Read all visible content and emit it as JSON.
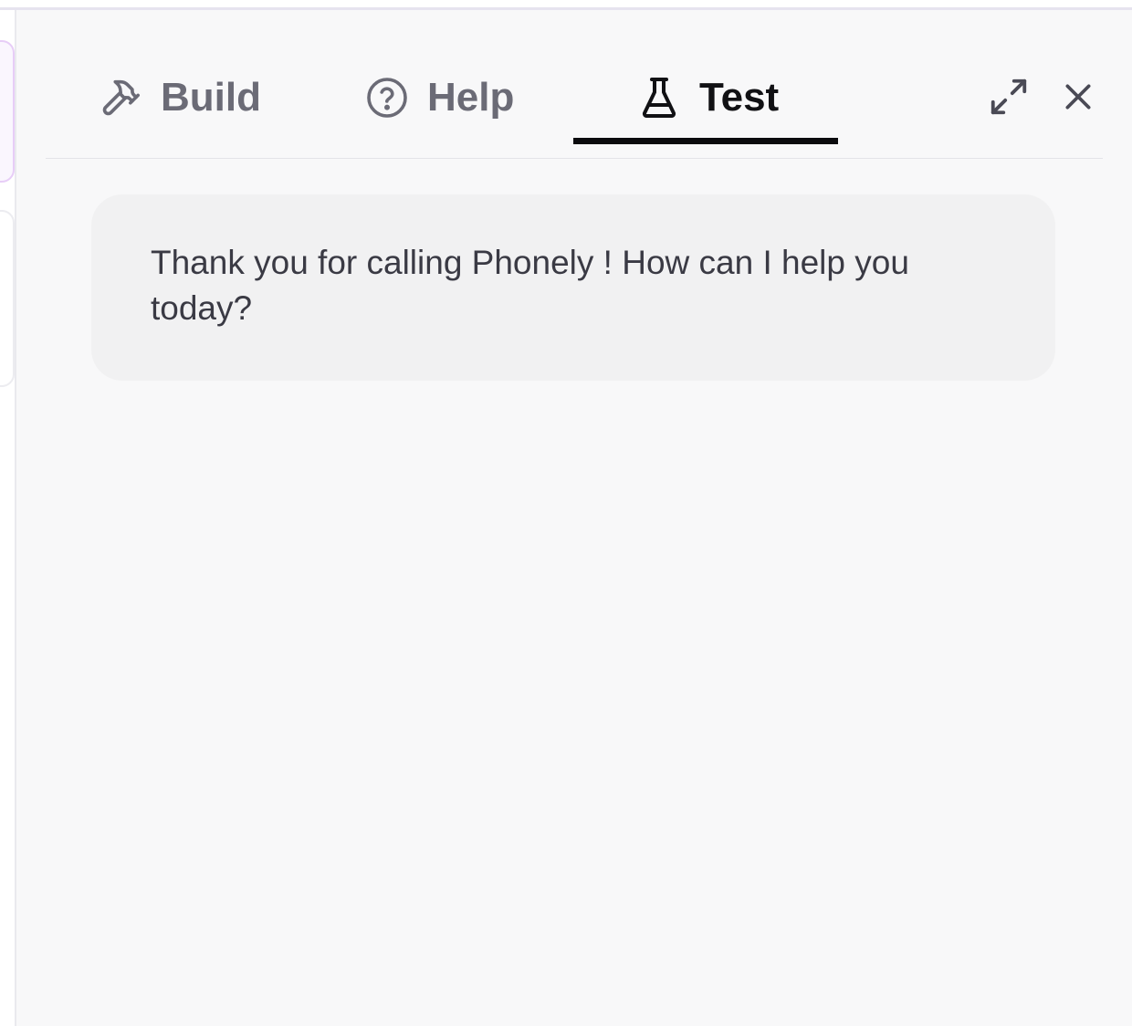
{
  "tabs": [
    {
      "label": "Build",
      "icon": "hammer-icon",
      "active": false
    },
    {
      "label": "Help",
      "icon": "question-circle-icon",
      "active": false
    },
    {
      "label": "Test",
      "icon": "flask-icon",
      "active": true
    }
  ],
  "window_controls": {
    "expand_icon": "expand-icon",
    "close_icon": "close-icon"
  },
  "chat": {
    "messages": [
      {
        "role": "assistant",
        "text": "Thank you for calling Phonely ! How can I help you today?"
      }
    ]
  },
  "colors": {
    "panel_bg": "#f8f8f9",
    "bubble_bg": "#f1f1f2",
    "active_tab": "#111114",
    "inactive_tab": "#6b6b76",
    "accent_border": "#e7cdf7"
  }
}
